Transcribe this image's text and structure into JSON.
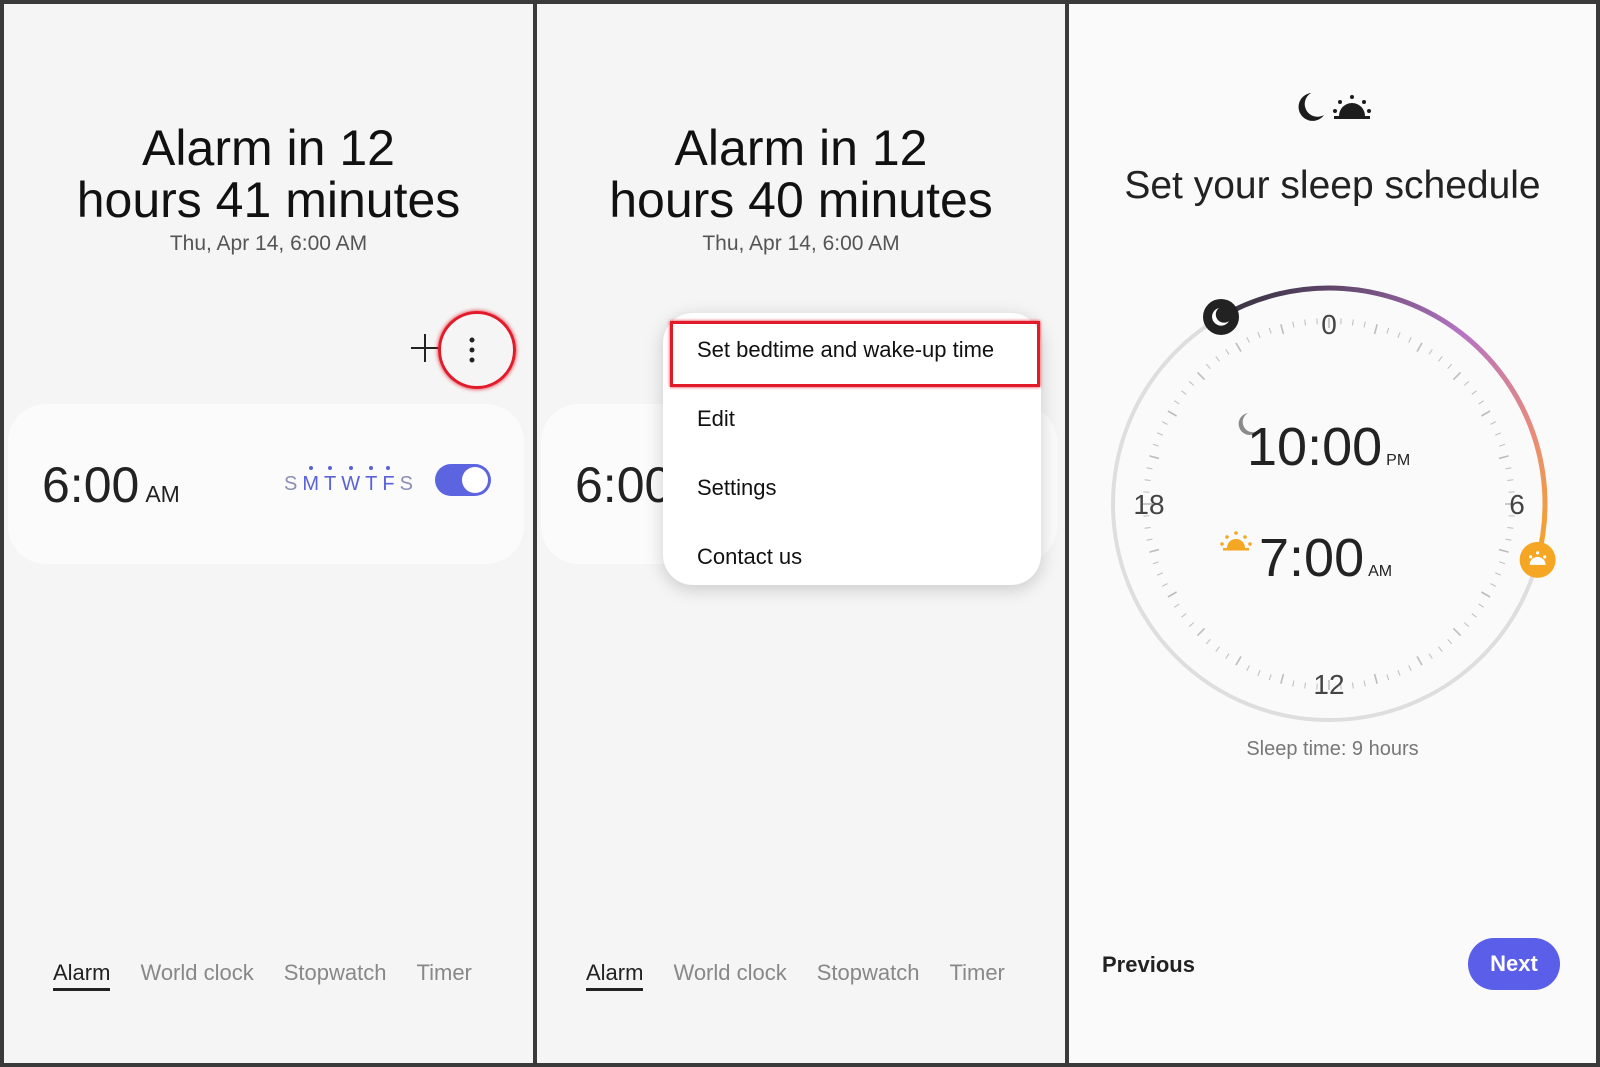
{
  "screen1": {
    "headline_line1": "Alarm in 12",
    "headline_line2": "hours 41 minutes",
    "subline": "Thu, Apr 14, 6:00 AM",
    "alarm": {
      "time": "6:00",
      "ampm": "AM",
      "days": [
        {
          "label": "S",
          "on": false
        },
        {
          "label": "M",
          "on": true
        },
        {
          "label": "T",
          "on": true
        },
        {
          "label": "W",
          "on": true
        },
        {
          "label": "T",
          "on": true
        },
        {
          "label": "F",
          "on": true
        },
        {
          "label": "S",
          "on": false
        }
      ],
      "enabled": true
    },
    "tabs": [
      "Alarm",
      "World clock",
      "Stopwatch",
      "Timer"
    ]
  },
  "screen2": {
    "headline_line1": "Alarm in 12",
    "headline_line2": "hours 40 minutes",
    "subline": "Thu, Apr 14, 6:00 AM",
    "alarm_time": "6:00",
    "menu": [
      "Set bedtime and wake-up time",
      "Edit",
      "Settings",
      "Contact us"
    ],
    "tabs": [
      "Alarm",
      "World clock",
      "Stopwatch",
      "Timer"
    ]
  },
  "screen3": {
    "title": "Set your sleep schedule",
    "dial_labels": {
      "top": "0",
      "right": "6",
      "bottom": "12",
      "left": "18"
    },
    "bedtime": {
      "time": "10:00",
      "ampm": "PM"
    },
    "wake": {
      "time": "7:00",
      "ampm": "AM"
    },
    "sleep_time": "Sleep time: 9 hours",
    "previous_label": "Previous",
    "next_label": "Next"
  },
  "colors": {
    "accent": "#5a5ee8",
    "highlight": "#e21b2a",
    "wake": "#f5a623",
    "arc_start": "#2b2b33",
    "arc_mid": "#b574c4"
  }
}
